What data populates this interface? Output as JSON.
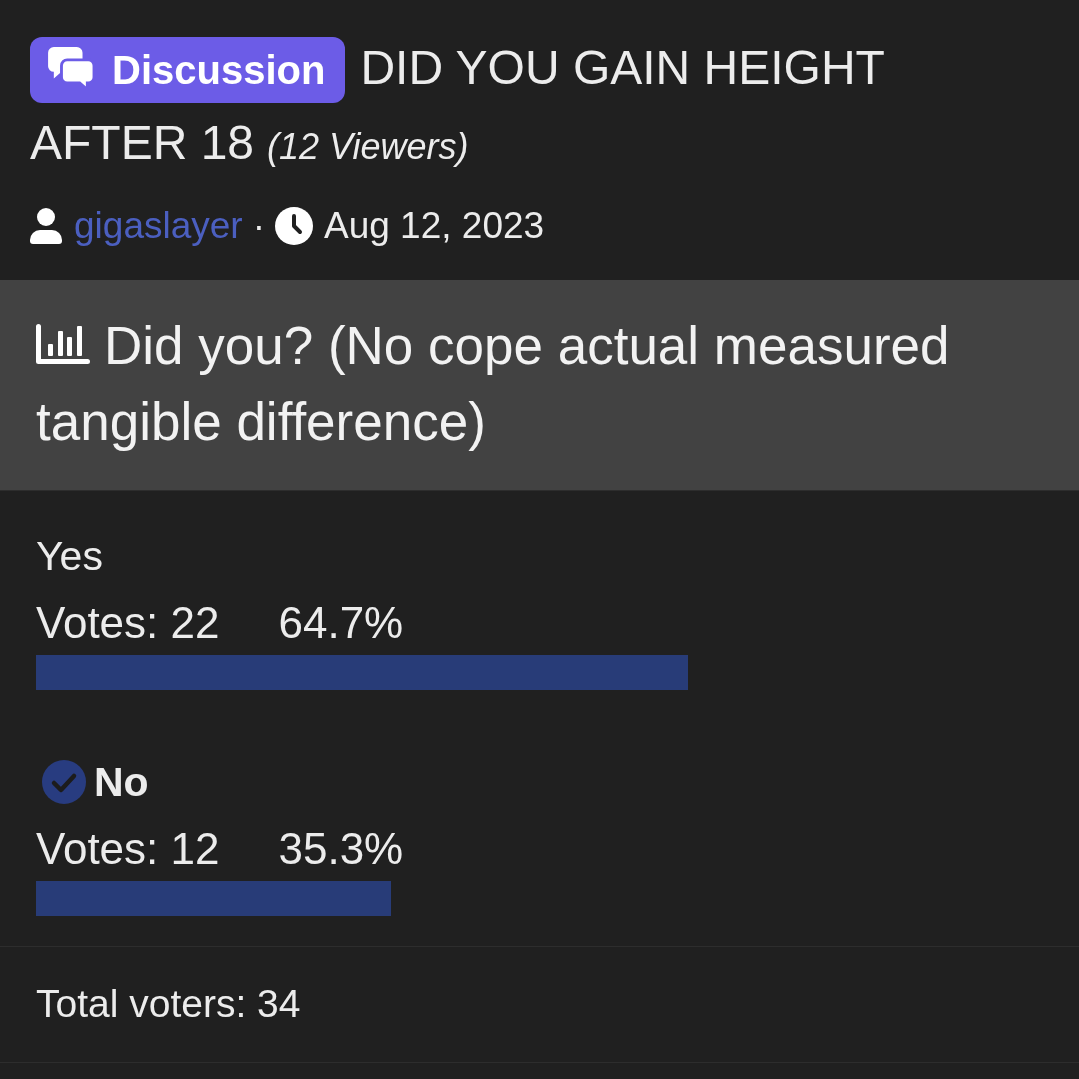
{
  "thread": {
    "prefix": "Discussion",
    "title": "DID YOU GAIN HEIGHT AFTER 18",
    "viewers": "(12 Viewers)",
    "author": "gigaslayer",
    "separator": "·",
    "date": "Aug 12, 2023"
  },
  "poll": {
    "question": "Did you? (No cope actual measured tangible difference)",
    "options": [
      {
        "label": "Yes",
        "selected": false,
        "votes": "Votes: 22",
        "percent": "64.7%",
        "level": 0.647
      },
      {
        "label": "No",
        "selected": true,
        "votes": "Votes: 12",
        "percent": "35.3%",
        "level": 0.353
      }
    ],
    "total": "Total voters: 34"
  }
}
